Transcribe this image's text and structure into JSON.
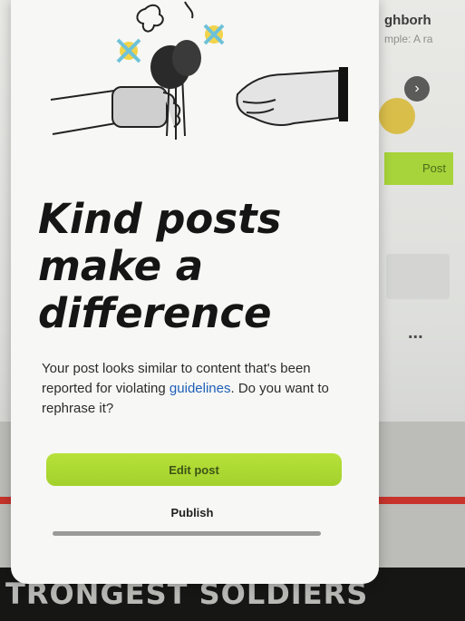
{
  "background": {
    "headline_fragment": "ghborh",
    "sub_fragment": "mple: A ra",
    "post_button_label": "Post",
    "more_label": "...",
    "banner_text": "TRONGEST SOLDIERS"
  },
  "modal": {
    "title": "Kind posts make a difference",
    "body_prefix": "Your post looks similar to content that's been reported for violating ",
    "guidelines_link": "guidelines",
    "body_suffix": ". Do you want to rephrase it?",
    "edit_button_label": "Edit post",
    "publish_button_label": "Publish"
  },
  "colors": {
    "accent": "#a9d532",
    "link": "#1d5fb8"
  }
}
